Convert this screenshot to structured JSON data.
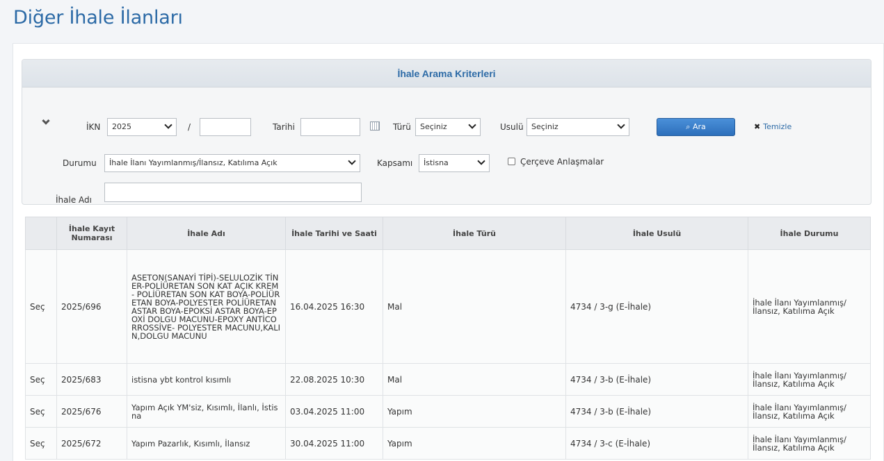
{
  "page": {
    "title": "Diğer İhale İlanları"
  },
  "criteria": {
    "title": "İhale Arama Kriterleri",
    "ikn_label": "İKN",
    "ikn_year": "2025",
    "ikn_separator": "/",
    "tarihi_label": "Tarihi",
    "turu_label": "Türü",
    "turu_value": "Seçiniz",
    "usulu_label": "Usulü",
    "usulu_value": "Seçiniz",
    "search_label": "Ara",
    "clear_label": "Temizle",
    "durumu_label": "Durumu",
    "durumu_value": "İhale İlanı Yayımlanmış/İlansız, Katılıma Açık",
    "kapsami_label": "Kapsamı",
    "kapsami_value": "İstisna",
    "cerceve_label": "Çerçeve Anlaşmalar",
    "ihale_adi_label": "İhale Adı"
  },
  "table": {
    "headers": [
      "",
      "İhale Kayıt Numarası",
      "İhale Adı",
      "İhale Tarihi ve Saati",
      "İhale Türü",
      "İhale Usulü",
      "İhale Durumu"
    ],
    "rows": [
      {
        "select": "Seç",
        "ikn": "2025/696",
        "name": "ASETON(SANAYİ TİPİ)-SELULOZİK TİNER-POLİÜRETAN SON KAT AÇIK KREM- POLİÜRETAN SON KAT BOYA-POLİÜRETAN BOYA-POLYESTER POLİÜRETAN ASTAR BOYA-EPOKSİ ASTAR BOYA-EPOXİ DOLGU MACUNU-EPOXY ANTİCORROSSİVE- POLYESTER MACUNU,KALIN,DOLGU MACUNU",
        "date": "16.04.2025 16:30",
        "type": "Mal",
        "method": "4734 / 3-g (E-İhale)",
        "status": "İhale İlanı Yayımlanmış/ İlansız, Katılıma Açık"
      },
      {
        "select": "Seç",
        "ikn": "2025/683",
        "name": "istisna ybt kontrol kısımlı",
        "date": "22.08.2025 10:30",
        "type": "Mal",
        "method": "4734 / 3-b (E-İhale)",
        "status": "İhale İlanı Yayımlanmış/ İlansız, Katılıma Açık"
      },
      {
        "select": "Seç",
        "ikn": "2025/676",
        "name": "Yapım Açık YM'siz, Kısımlı, İlanlı, İstisna",
        "date": "03.04.2025 11:00",
        "type": "Yapım",
        "method": "4734 / 3-b (E-İhale)",
        "status": "İhale İlanı Yayımlanmış/ İlansız, Katılıma Açık"
      },
      {
        "select": "Seç",
        "ikn": "2025/672",
        "name": "Yapım Pazarlık, Kısımlı, İlansız",
        "date": "30.04.2025 11:00",
        "type": "Yapım",
        "method": "4734 / 3-c (E-İhale)",
        "status": "İhale İlanı Yayımlanmış/ İlansız, Katılıma Açık"
      }
    ]
  }
}
